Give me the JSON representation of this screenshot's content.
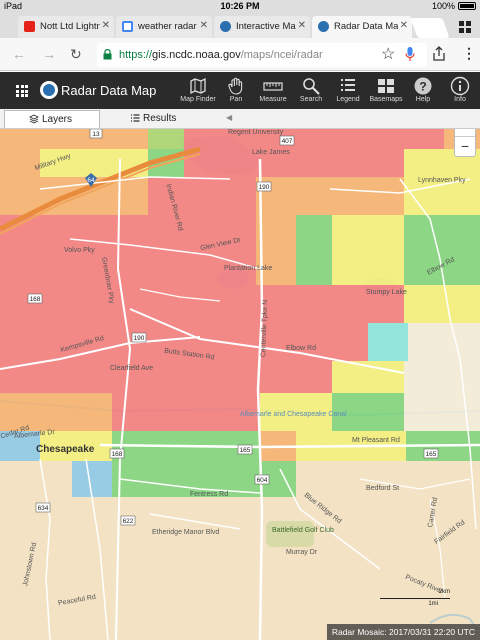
{
  "status_bar": {
    "device": "iPad",
    "time": "10:26 PM",
    "battery": "100%"
  },
  "tabs": [
    {
      "title": "Nott Ltd Lightni",
      "favicon_color": "#e62117"
    },
    {
      "title": "weather radar arc",
      "favicon_color": "#4285f4"
    },
    {
      "title": "Interactive Map T",
      "favicon_color": "#2a6fb0"
    },
    {
      "title": "Radar Data Map |",
      "favicon_color": "#2a6fb0"
    }
  ],
  "omnibox": {
    "scheme": "https://",
    "host": "gis.ncdc.noaa.gov",
    "path": "/maps/ncei/radar"
  },
  "app": {
    "title": "Radar Data Map",
    "tools": [
      {
        "label": "Map Finder",
        "icon": "map-finder-icon"
      },
      {
        "label": "Pan",
        "icon": "hand-icon"
      },
      {
        "label": "Measure",
        "icon": "ruler-icon"
      },
      {
        "label": "Search",
        "icon": "search-icon"
      },
      {
        "label": "Legend",
        "icon": "legend-icon"
      },
      {
        "label": "Basemaps",
        "icon": "basemaps-icon"
      },
      {
        "label": "Help",
        "icon": "help-icon"
      },
      {
        "label": "Info",
        "icon": "info-icon"
      }
    ]
  },
  "panel": {
    "tabs": [
      {
        "label": "Layers"
      },
      {
        "label": "Results"
      }
    ]
  },
  "zoom": {
    "in": "+",
    "out": "−"
  },
  "map": {
    "labels": [
      {
        "text": "Regent University",
        "kind": "place"
      },
      {
        "text": "Lake James",
        "kind": "water"
      },
      {
        "text": "Military Hwy",
        "kind": "road"
      },
      {
        "text": "Indian River Rd",
        "kind": "road"
      },
      {
        "text": "Volvo Pky",
        "kind": "road"
      },
      {
        "text": "Greenbrier Pky",
        "kind": "road"
      },
      {
        "text": "Kempsville Rd",
        "kind": "road"
      },
      {
        "text": "Glen View Dr",
        "kind": "road"
      },
      {
        "text": "Plantation Lake",
        "kind": "water"
      },
      {
        "text": "Centerville Tpke N",
        "kind": "road"
      },
      {
        "text": "Elbow Rd",
        "kind": "road"
      },
      {
        "text": "Butts Station Rd",
        "kind": "road"
      },
      {
        "text": "Clearfield Ave",
        "kind": "road"
      },
      {
        "text": "Albemarle and Chesapeake Canal",
        "kind": "water"
      },
      {
        "text": "Chesapeake",
        "kind": "city"
      },
      {
        "text": "Mt Pleasant Rd",
        "kind": "road"
      },
      {
        "text": "Battlefield Golf Club",
        "kind": "park"
      },
      {
        "text": "Fentress Rd",
        "kind": "road"
      },
      {
        "text": "Blue Ridge Rd",
        "kind": "road"
      },
      {
        "text": "Etheridge Manor Blvd",
        "kind": "road"
      },
      {
        "text": "Johnstown Rd",
        "kind": "road"
      },
      {
        "text": "Peaceful Rd",
        "kind": "road"
      },
      {
        "text": "Murray Dr",
        "kind": "road"
      },
      {
        "text": "Pocaty River",
        "kind": "water"
      },
      {
        "text": "Elbow Rd",
        "kind": "road"
      },
      {
        "text": "Lynnhaven Pky",
        "kind": "road"
      },
      {
        "text": "Stumpy Lake",
        "kind": "water"
      },
      {
        "text": "Bedford St",
        "kind": "road"
      },
      {
        "text": "Carter Rd",
        "kind": "road"
      },
      {
        "text": "Fairfield Rd",
        "kind": "road"
      },
      {
        "text": "Cedar Rd",
        "kind": "road"
      },
      {
        "text": "Albemarle Dr",
        "kind": "road"
      }
    ],
    "shields": [
      "13",
      "64",
      "407",
      "190",
      "168",
      "190",
      "168",
      "165",
      "604",
      "634",
      "622",
      "165"
    ],
    "scale": {
      "top": "2km",
      "bottom": "1mi"
    },
    "mosaic_label": "Radar Mosaic: 2017/03/31 22:20 UTC"
  },
  "colors": {
    "radar_red": "#f47c7c",
    "radar_orange": "#f6b06e",
    "radar_yellow": "#f5f07a",
    "radar_green": "#7ed37a",
    "radar_cyan": "#86e3dc",
    "radar_blue": "#8cc8e6"
  }
}
